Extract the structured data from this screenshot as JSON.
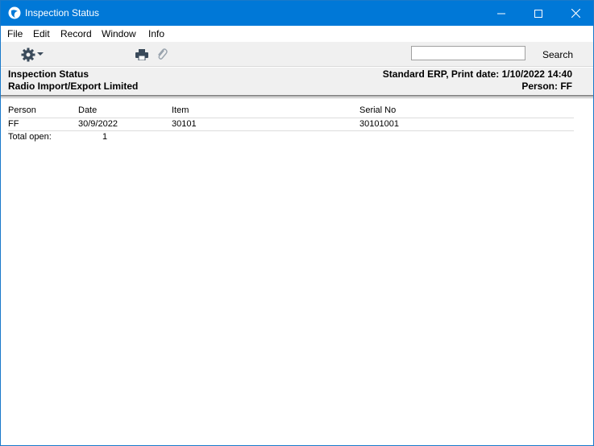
{
  "window": {
    "title": "Inspection Status"
  },
  "menu": [
    "File",
    "Edit",
    "Record",
    "Window",
    "Info"
  ],
  "toolbar": {
    "icons": [
      "gear-icon",
      "print-icon",
      "paperclip-icon"
    ],
    "search_value": "",
    "search_label": "Search"
  },
  "report": {
    "title": "Inspection Status",
    "company": "Radio Import/Export Limited",
    "print_info": "Standard ERP, Print date: 1/10/2022 14:40",
    "person_filter": "Person: FF"
  },
  "table": {
    "columns": [
      "Person",
      "Date",
      "Item",
      "Serial No"
    ],
    "rows": [
      {
        "person": "FF",
        "date": "30/9/2022",
        "item": "30101",
        "serial": "30101001"
      }
    ],
    "total_label": "Total open:",
    "total_value": "1"
  },
  "colors": {
    "titlebar": "#0078d7",
    "toolbar": "#f0f0f0"
  }
}
